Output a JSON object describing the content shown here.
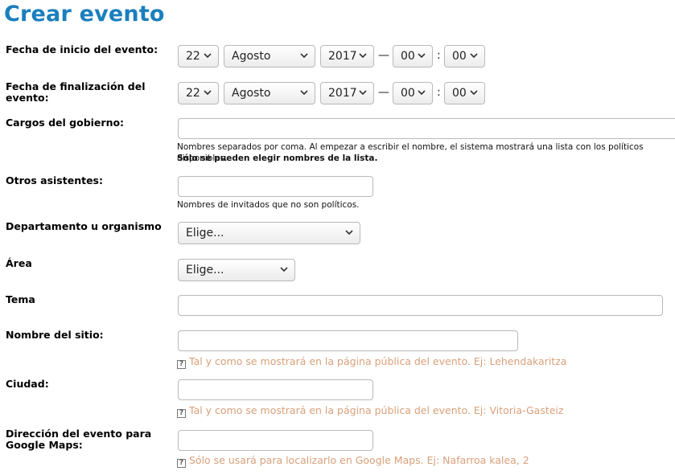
{
  "page": {
    "title": "Crear evento"
  },
  "form": {
    "start": {
      "label": "Fecha de inicio del evento:",
      "day": "22",
      "month": "Agosto",
      "year": "2017",
      "hour": "00",
      "minute": "00",
      "dash": "—",
      "colon": ":"
    },
    "end": {
      "label": "Fecha de finalización del evento:",
      "day": "22",
      "month": "Agosto",
      "year": "2017",
      "hour": "00",
      "minute": "00",
      "dash": "—",
      "colon": ":"
    },
    "cargos": {
      "label": "Cargos del gobierno:",
      "value": "",
      "help": "Nombres separados por coma. Al empezar a escribir el nombre, el sistema mostrará una lista con los políticos disponibles.",
      "help_bold": "Sólo se pueden elegir nombres de la lista."
    },
    "otros": {
      "label": "Otros asistentes:",
      "value": "",
      "help": "Nombres de invitados que no son políticos."
    },
    "departamento": {
      "label": "Departamento u organismo",
      "selected": "Elige..."
    },
    "area": {
      "label": "Área",
      "selected": "Elige..."
    },
    "tema": {
      "label": "Tema",
      "value": ""
    },
    "sitio": {
      "label": "Nombre del sitio:",
      "value": "",
      "hint": "Tal y como se mostrará en la página pública del evento. Ej: Lehendakaritza"
    },
    "ciudad": {
      "label": "Ciudad:",
      "value": "",
      "hint": "Tal y como se mostrará en la página pública del evento. Ej: Vitoria-Gasteiz"
    },
    "direccion": {
      "label": "Dirección del evento para Google Maps:",
      "value": "",
      "hint": "Sólo se usará para localizarlo en Google Maps. Ej: Nafarroa kalea, 2"
    }
  },
  "icons": {
    "select_arrow": "chevron-down-icon",
    "help": "question-icon"
  },
  "colors": {
    "title": "#1a7fbd",
    "hint": "#d8a07a"
  }
}
